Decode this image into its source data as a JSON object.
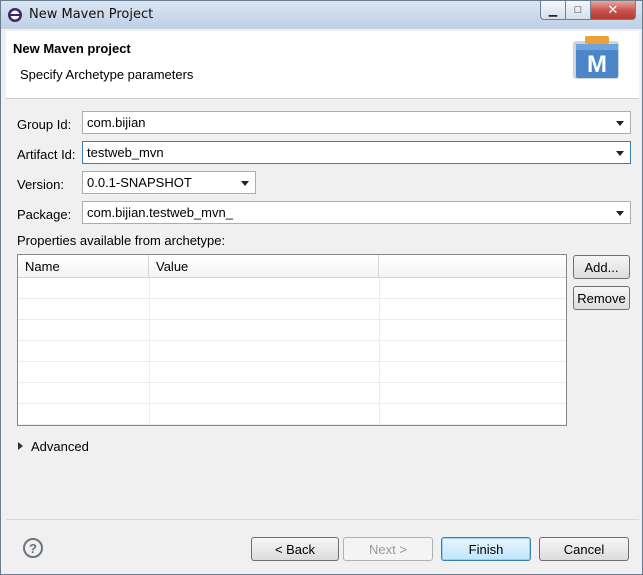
{
  "window": {
    "title": "New Maven Project",
    "min_glyph": "▁",
    "max_glyph": "□",
    "close_glyph": "✕"
  },
  "header": {
    "title": "New Maven project",
    "subtitle": "Specify Archetype parameters",
    "logo_letter": "M"
  },
  "form": {
    "group_id_label": "Group Id:",
    "group_id_value": "com.bijian",
    "artifact_id_label": "Artifact Id:",
    "artifact_id_value": "testweb_mvn",
    "version_label": "Version:",
    "version_value": "0.0.1-SNAPSHOT",
    "package_label": "Package:",
    "package_value": "com.bijian.testweb_mvn_"
  },
  "properties": {
    "label": "Properties available from archetype:",
    "columns": [
      "Name",
      "Value"
    ],
    "rows": [],
    "add_button": "Add...",
    "remove_button": "Remove"
  },
  "advanced": {
    "label": "Advanced"
  },
  "footer": {
    "help_glyph": "?",
    "back": "< Back",
    "next": "Next >",
    "finish": "Finish",
    "cancel": "Cancel"
  },
  "colors": {
    "accent": "#3c7fb1",
    "logo": "#4a86c8",
    "close": "#c75050"
  }
}
